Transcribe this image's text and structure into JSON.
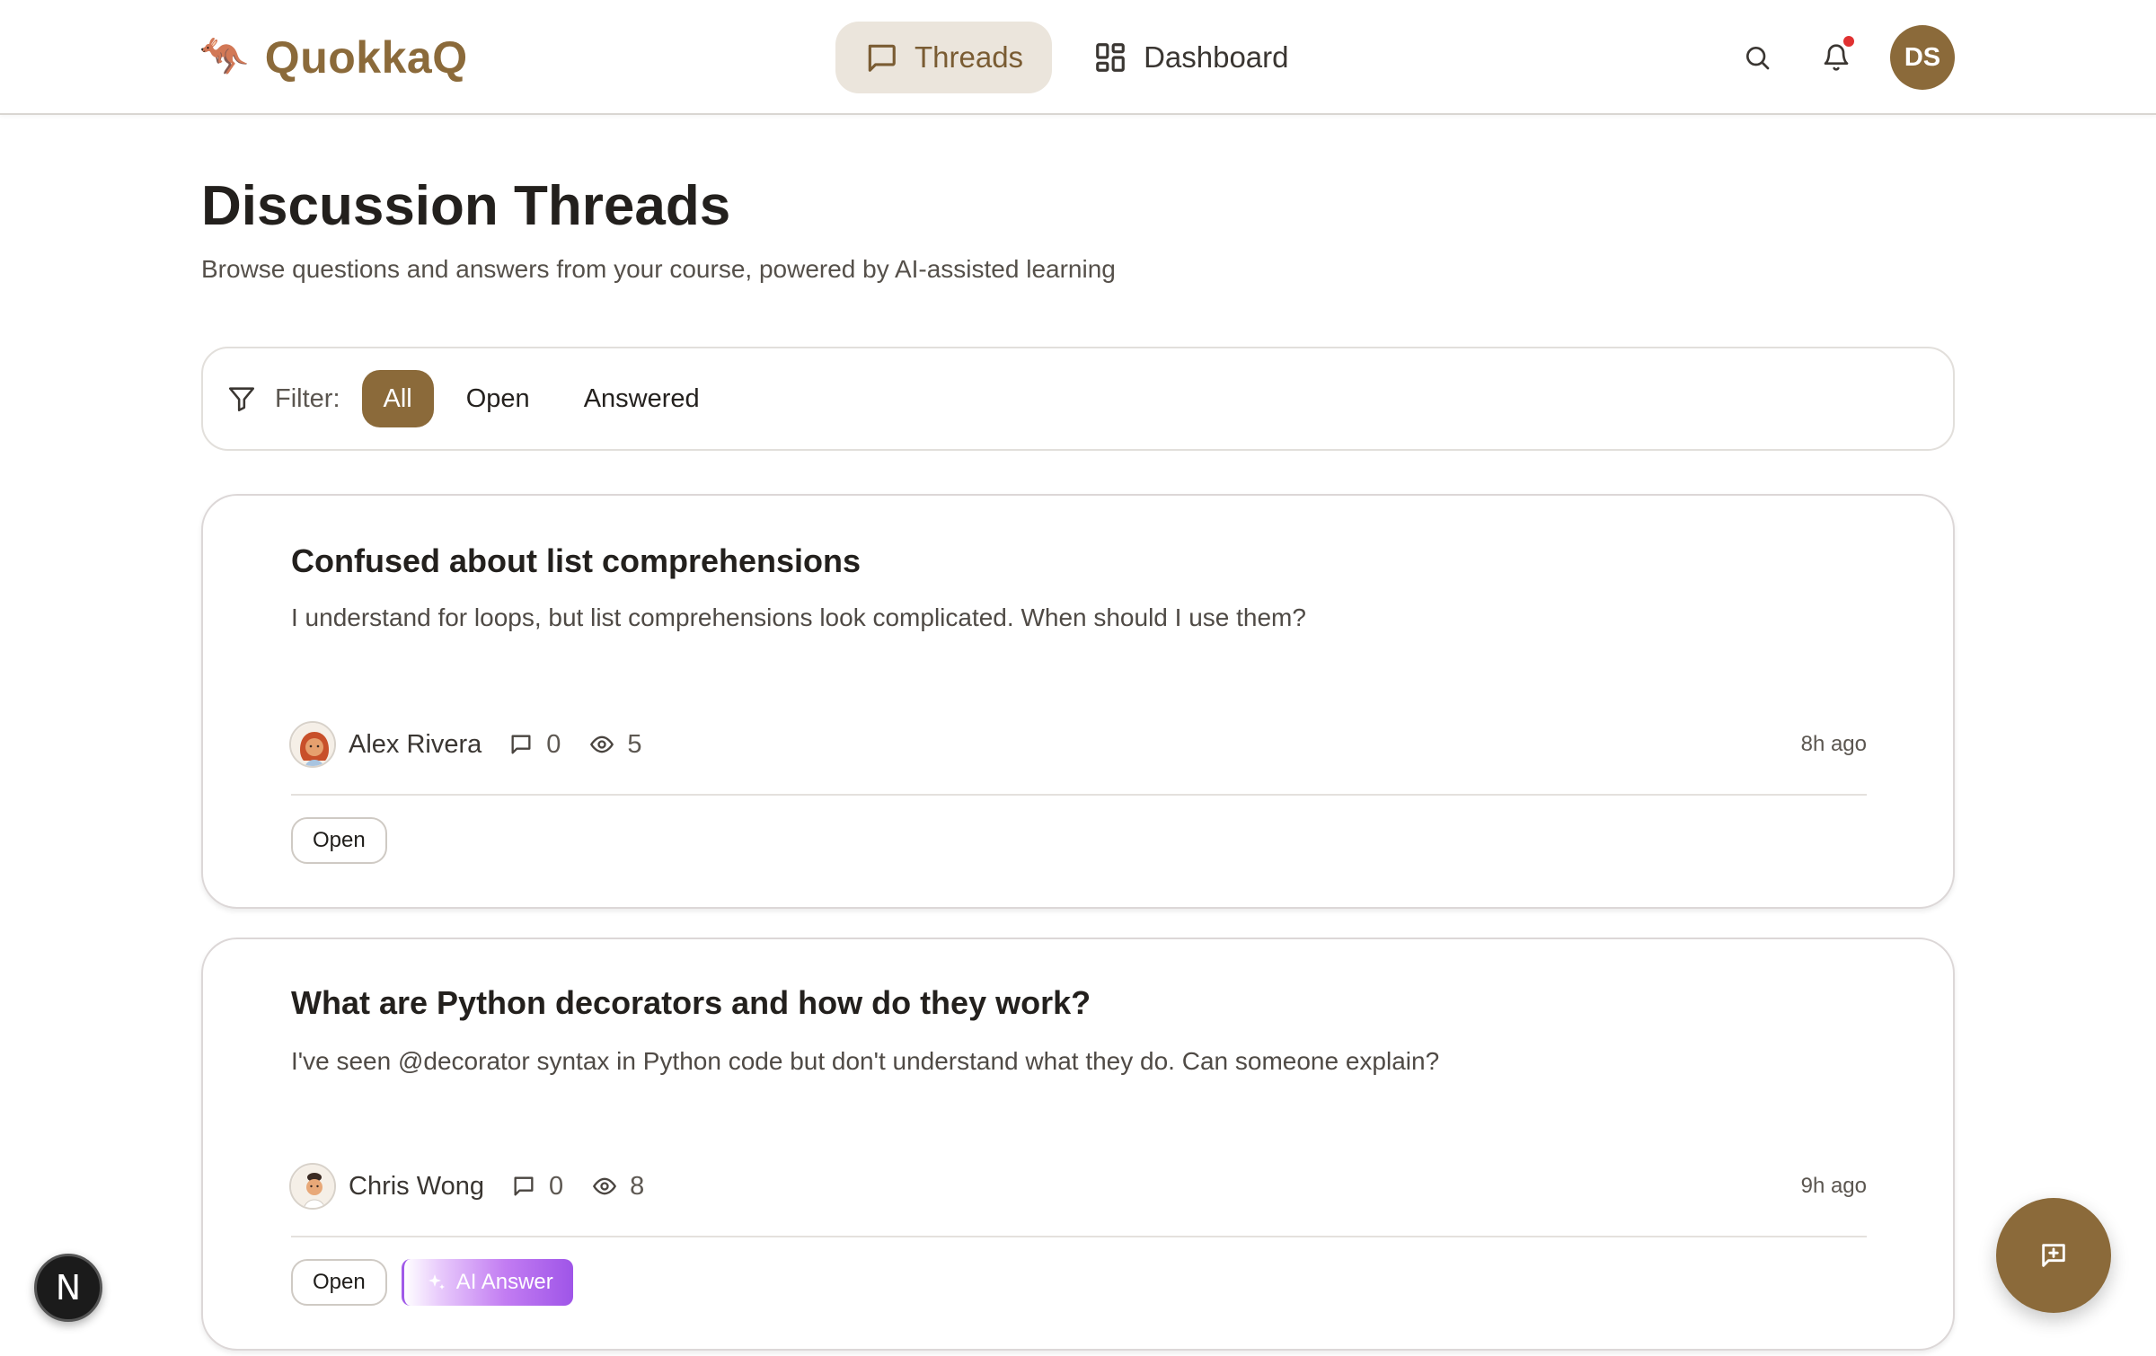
{
  "header": {
    "brand_logo": "🦘",
    "brand_name": "QuokkaQ",
    "nav": [
      {
        "label": "Threads",
        "icon": "chat-bubble-icon",
        "active": true
      },
      {
        "label": "Dashboard",
        "icon": "grid-icon",
        "active": false
      }
    ],
    "user_initials": "DS",
    "has_notification": true
  },
  "page": {
    "title": "Discussion Threads",
    "subtitle": "Browse questions and answers from your course, powered by AI-assisted learning"
  },
  "filter": {
    "label": "Filter:",
    "options": [
      "All",
      "Open",
      "Answered"
    ],
    "selected": "All"
  },
  "threads": [
    {
      "title": "Confused about list comprehensions",
      "excerpt": "I understand for loops, but list comprehensions look complicated. When should I use them?",
      "author": "Alex Rivera",
      "replies": "0",
      "views": "5",
      "time": "8h ago",
      "status": "Open",
      "ai_answer": null
    },
    {
      "title": "What are Python decorators and how do they work?",
      "excerpt": "I've seen @decorator syntax in Python code but don't understand what they do. Can someone explain?",
      "author": "Chris Wong",
      "replies": "0",
      "views": "8",
      "time": "9h ago",
      "status": "Open",
      "ai_answer": "AI Answer"
    }
  ],
  "floating": {
    "dev_badge": "N"
  },
  "colors": {
    "brand": "#8b6a3a",
    "nav_active_bg": "#ebe5dc",
    "notification": "#e03131",
    "ai_gradient_end": "#9f55e8"
  }
}
